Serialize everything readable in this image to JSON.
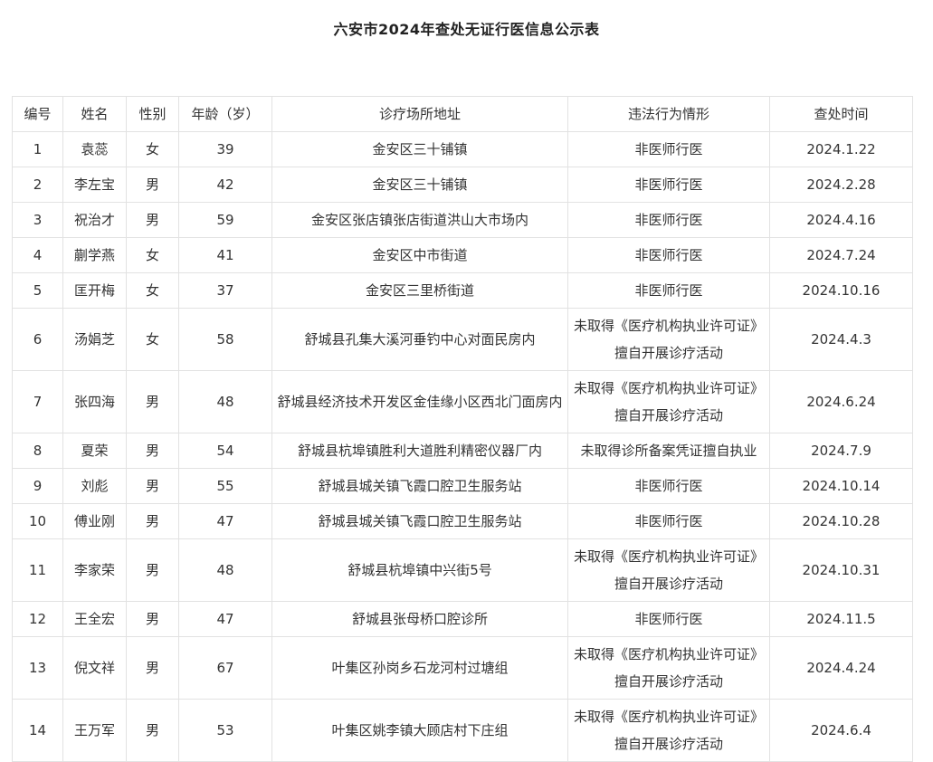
{
  "title": "六安市2024年查处无证行医信息公示表",
  "columns": [
    "编号",
    "姓名",
    "性别",
    "年龄（岁）",
    "诊疗场所地址",
    "违法行为情形",
    "查处时间"
  ],
  "rows": [
    {
      "no": "1",
      "name": "袁蕊",
      "gender": "女",
      "age": "39",
      "address": "金安区三十铺镇",
      "violation": "非医师行医",
      "date": "2024.1.22"
    },
    {
      "no": "2",
      "name": "李左宝",
      "gender": "男",
      "age": "42",
      "address": "金安区三十铺镇",
      "violation": "非医师行医",
      "date": "2024.2.28"
    },
    {
      "no": "3",
      "name": "祝治才",
      "gender": "男",
      "age": "59",
      "address": "金安区张店镇张店街道洪山大市场内",
      "violation": "非医师行医",
      "date": "2024.4.16"
    },
    {
      "no": "4",
      "name": "蒯学燕",
      "gender": "女",
      "age": "41",
      "address": "金安区中市街道",
      "violation": "非医师行医",
      "date": "2024.7.24"
    },
    {
      "no": "5",
      "name": "匡开梅",
      "gender": "女",
      "age": "37",
      "address": "金安区三里桥街道",
      "violation": "非医师行医",
      "date": "2024.10.16"
    },
    {
      "no": "6",
      "name": "汤娟芝",
      "gender": "女",
      "age": "58",
      "address": "舒城县孔集大溪河垂钓中心对面民房内",
      "violation": "未取得《医疗机构执业许可证》擅自开展诊疗活动",
      "date": "2024.4.3"
    },
    {
      "no": "7",
      "name": "张四海",
      "gender": "男",
      "age": "48",
      "address": "舒城县经济技术开发区金佳缘小区西北门面房内",
      "violation": "未取得《医疗机构执业许可证》擅自开展诊疗活动",
      "date": "2024.6.24"
    },
    {
      "no": "8",
      "name": "夏荣",
      "gender": "男",
      "age": "54",
      "address": "舒城县杭埠镇胜利大道胜利精密仪器厂内",
      "violation": "未取得诊所备案凭证擅自执业",
      "date": "2024.7.9"
    },
    {
      "no": "9",
      "name": "刘彪",
      "gender": "男",
      "age": "55",
      "address": "舒城县城关镇飞霞口腔卫生服务站",
      "violation": "非医师行医",
      "date": "2024.10.14"
    },
    {
      "no": "10",
      "name": "傅业刚",
      "gender": "男",
      "age": "47",
      "address": "舒城县城关镇飞霞口腔卫生服务站",
      "violation": "非医师行医",
      "date": "2024.10.28"
    },
    {
      "no": "11",
      "name": "李家荣",
      "gender": "男",
      "age": "48",
      "address": "舒城县杭埠镇中兴街5号",
      "violation": "未取得《医疗机构执业许可证》擅自开展诊疗活动",
      "date": "2024.10.31"
    },
    {
      "no": "12",
      "name": "王全宏",
      "gender": "男",
      "age": "47",
      "address": "舒城县张母桥口腔诊所",
      "violation": "非医师行医",
      "date": "2024.11.5"
    },
    {
      "no": "13",
      "name": "倪文祥",
      "gender": "男",
      "age": "67",
      "address": "叶集区孙岗乡石龙河村过塘组",
      "violation": "未取得《医疗机构执业许可证》擅自开展诊疗活动",
      "date": "2024.4.24"
    },
    {
      "no": "14",
      "name": "王万军",
      "gender": "男",
      "age": "53",
      "address": "叶集区姚李镇大顾店村下庄组",
      "violation": "未取得《医疗机构执业许可证》擅自开展诊疗活动",
      "date": "2024.6.4"
    }
  ]
}
